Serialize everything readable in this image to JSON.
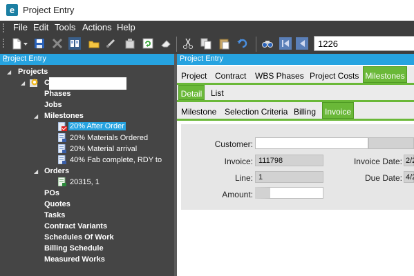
{
  "window": {
    "title": "Project Entry",
    "app_icon_letter": "e"
  },
  "menu": [
    "File",
    "Edit",
    "Tools",
    "Actions",
    "Help"
  ],
  "toolbar": {
    "icons": [
      "new-document-icon",
      "dropdown-arrow-icon",
      "save-icon",
      "delete-icon",
      "book-icon",
      "folder-icon",
      "link-icon",
      "attach-icon",
      "refresh-icon",
      "eraser-icon",
      "cut-icon",
      "copy-icon",
      "paste-icon",
      "undo-icon",
      "find-icon",
      "first-record-icon",
      "previous-record-icon"
    ],
    "record_number": "1226"
  },
  "left_panel": {
    "title": "Project Entry",
    "pin_glyph": "⊥",
    "tree": [
      {
        "label": "Projects",
        "level": 0,
        "expanded": true
      },
      {
        "label": "C",
        "level": 1,
        "expanded": true
      },
      {
        "label": "Phases",
        "level": 2
      },
      {
        "label": "Jobs",
        "level": 2
      },
      {
        "label": "Milestones",
        "level": 2,
        "expanded": true
      },
      {
        "label": "20% After Order",
        "level": 3,
        "selected": true
      },
      {
        "label": "20% Materials Ordered",
        "level": 3
      },
      {
        "label": "20% Material arrival",
        "level": 3
      },
      {
        "label": "40% Fab complete, RDY to",
        "level": 3
      },
      {
        "label": "Orders",
        "level": 2,
        "expanded": true
      },
      {
        "label": "20315, 1",
        "level": 3
      },
      {
        "label": "POs",
        "level": 2
      },
      {
        "label": "Quotes",
        "level": 2
      },
      {
        "label": "Tasks",
        "level": 2
      },
      {
        "label": "Contract Variants",
        "level": 2
      },
      {
        "label": "Schedules Of Work",
        "level": 2
      },
      {
        "label": "Billing Schedule",
        "level": 2
      },
      {
        "label": "Measured Works",
        "level": 2
      }
    ]
  },
  "right_panel": {
    "title": "Project Entry",
    "main_tabs": [
      "Project",
      "Contract",
      "WBS Phases",
      "Project Costs",
      "Milestones"
    ],
    "active_main_tab": "Milestones",
    "view_tabs": [
      "Detail",
      "List"
    ],
    "active_view_tab": "Detail",
    "sub_tabs": [
      "Milestone",
      "Selection Criteria",
      "Billing",
      "Invoice"
    ],
    "active_sub_tab": "Invoice",
    "form": {
      "customer_label": "Customer:",
      "customer_value": "",
      "invoice_label": "Invoice:",
      "invoice_value": "111798",
      "invoice_date_label": "Invoice Date:",
      "invoice_date_value": "2/2",
      "line_label": "Line:",
      "line_value": "1",
      "due_date_label": "Due Date:",
      "due_date_value": "4/2",
      "amount_label": "Amount:",
      "amount_value": ""
    }
  },
  "colors": {
    "accent": "#26a3e0",
    "active_tab": "#6ab838",
    "panel_dark": "#454545"
  }
}
